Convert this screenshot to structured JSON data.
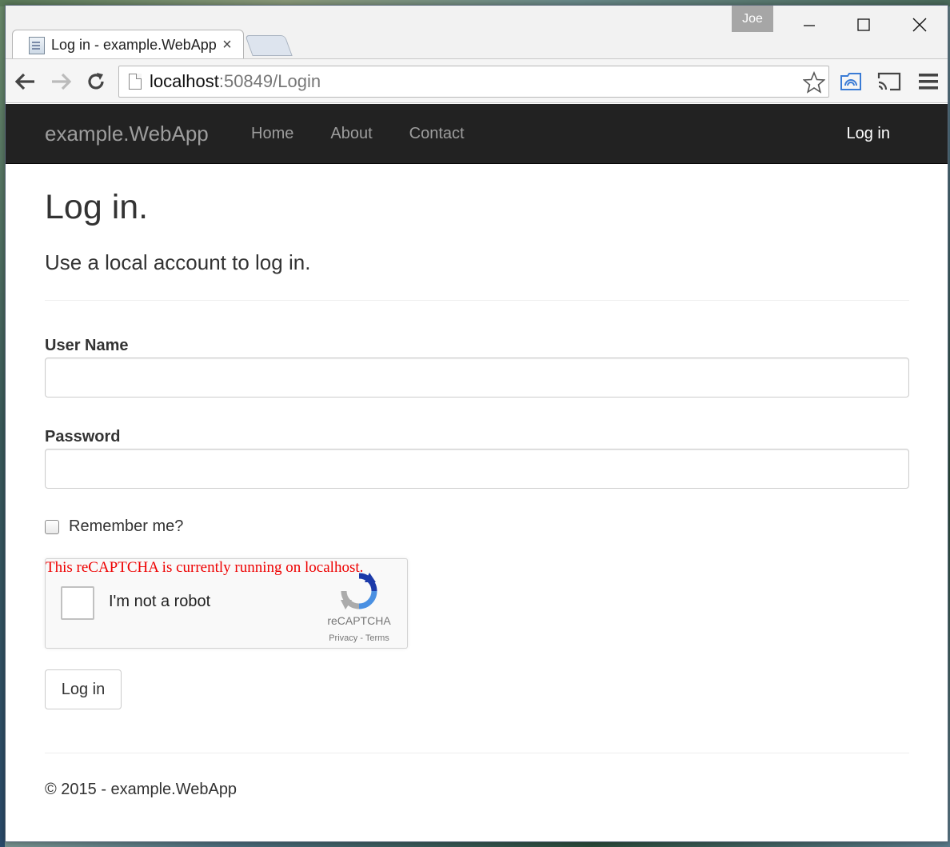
{
  "browser": {
    "profile_name": "Joe",
    "tab_title": "Log in - example.WebApp",
    "tab_close": "×",
    "url_host": "localhost",
    "url_rest": ":50849/Login"
  },
  "navbar": {
    "brand": "example.WebApp",
    "links": [
      "Home",
      "About",
      "Contact"
    ],
    "login": "Log in"
  },
  "page": {
    "title": "Log in.",
    "subtitle": "Use a local account to log in."
  },
  "form": {
    "username_label": "User Name",
    "username_value": "",
    "password_label": "Password",
    "password_value": "",
    "remember_label": "Remember me?",
    "remember_checked": false,
    "submit_label": "Log in"
  },
  "captcha": {
    "warning": "This reCAPTCHA is currently running on localhost.",
    "label": "I'm not a robot",
    "brand": "reCAPTCHA",
    "links": "Privacy - Terms",
    "checked": false
  },
  "footer": {
    "text": "© 2015 - example.WebApp"
  },
  "colors": {
    "navbar_bg": "#222222",
    "nav_link": "#9d9d9d",
    "captcha_warning": "#ee0000",
    "captcha_logo_blue": "#4a90e2",
    "captcha_logo_dark": "#1c3aa9"
  },
  "icons": [
    "page-icon",
    "back-arrow-icon",
    "forward-arrow-icon",
    "reload-icon",
    "star-icon",
    "extension-icon",
    "cast-icon",
    "menu-icon",
    "minimize-icon",
    "maximize-icon",
    "close-icon",
    "recaptcha-logo-icon"
  ]
}
